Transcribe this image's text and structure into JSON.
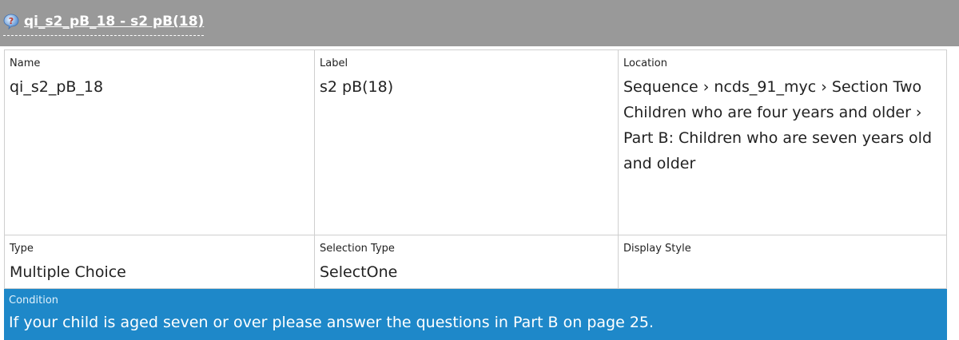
{
  "header": {
    "title": "qi_s2_pB_18 - s2 pB(18)",
    "icon": "help-question-icon"
  },
  "fields": {
    "name_label": "Name",
    "name_value": "qi_s2_pB_18",
    "label_label": "Label",
    "label_value": "s2 pB(18)",
    "location_label": "Location",
    "location_value": "Sequence › ncds_91_myc › Section Two Children who are four years and older › Part B: Children who are seven years old and older",
    "type_label": "Type",
    "type_value": "Multiple Choice",
    "selection_type_label": "Selection Type",
    "selection_type_value": "SelectOne",
    "display_style_label": "Display Style",
    "display_style_value": ""
  },
  "condition": {
    "label": "Condition",
    "text": "If your child is aged seven or over please answer the questions in Part B on page 25."
  },
  "colors": {
    "header_bg": "#999999",
    "condition_bg": "#1e88c9",
    "border": "#cfcfcf"
  }
}
